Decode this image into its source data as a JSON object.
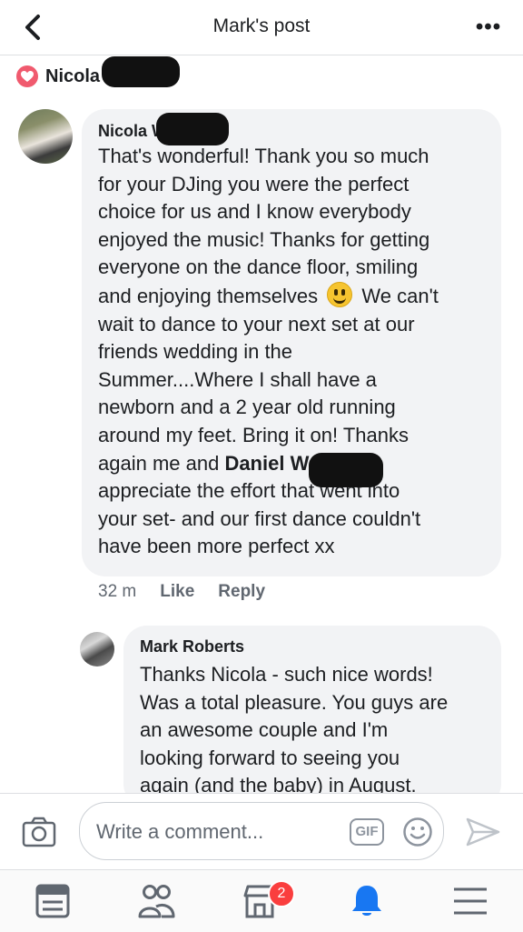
{
  "header": {
    "title": "Mark's post"
  },
  "reaction": {
    "name": "Nicola W"
  },
  "comments": [
    {
      "author": "Nicola W",
      "text_a": "That's wonderful! Thank you so much\nfor your DJing you were the perfect\nchoice for us and I know everybody\nenjoyed the music!  Thanks for getting\neveryone on the dance floor, smiling\nand enjoying themselves ",
      "text_b": " We can't\nwait to dance to your next set at our\nfriends wedding in the\nSummer....Where I shall have a\nnewborn and a 2 year old running\naround my feet. Bring it on! Thanks\nagain me and ",
      "mention": "Daniel W",
      "text_c": " really\nappreciate the effort that went into\nyour set- and our first dance couldn't\nhave been more perfect xx",
      "time": "32 m",
      "like": "Like",
      "reply": "Reply"
    },
    {
      "author": "Mark Roberts",
      "text": "Thanks Nicola - such nice words!\nWas a total pleasure. You guys are\nan awesome couple and I'm\nlooking forward to seeing you\nagain (and the baby) in August."
    }
  ],
  "composer": {
    "placeholder": "Write a comment...",
    "gif_label": "GIF"
  },
  "tabbar": {
    "notifications_badge": "2",
    "active_tab": "notifications",
    "active_color": "#1877f2"
  },
  "colors": {
    "accent": "#1877f2",
    "heart": "#f05a6e",
    "badge": "#fa3e3e",
    "bubble": "#f2f3f5"
  }
}
